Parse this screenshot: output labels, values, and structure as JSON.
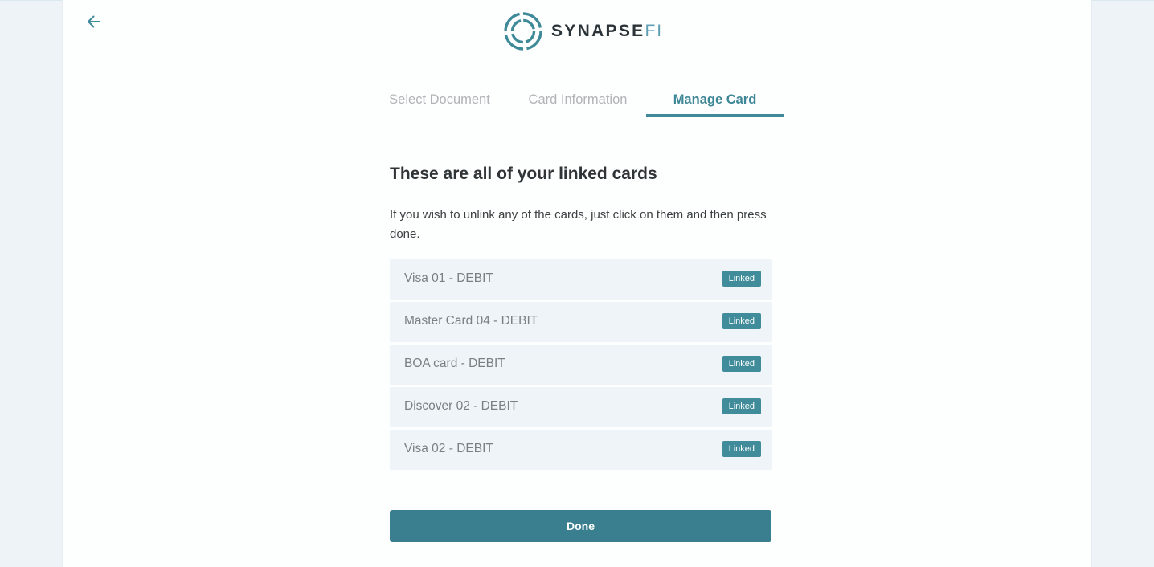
{
  "nav": {
    "back_icon": "arrow-left-icon"
  },
  "logo": {
    "icon": "synapsefi-ring-logo",
    "brand_main": "SYNAPSE",
    "brand_suffix": "FI"
  },
  "tabs": [
    {
      "label": "Select Document",
      "active": false
    },
    {
      "label": "Card Information",
      "active": false
    },
    {
      "label": "Manage Card",
      "active": true
    }
  ],
  "main": {
    "heading": "These are all of your linked cards",
    "description": "If you wish to unlink any of the cards, just click on them and then press done.",
    "cards": [
      {
        "name": "Visa 01 - DEBIT",
        "status": "Linked"
      },
      {
        "name": "Master Card 04 - DEBIT",
        "status": "Linked"
      },
      {
        "name": "BOA card - DEBIT",
        "status": "Linked"
      },
      {
        "name": "Discover 02 - DEBIT",
        "status": "Linked"
      },
      {
        "name": "Visa 02 - DEBIT",
        "status": "Linked"
      }
    ],
    "done_label": "Done"
  },
  "colors": {
    "accent": "#3f8a99",
    "button": "#3a7f8f",
    "card_bg": "#eef4f8",
    "page_bg": "#eef3f8"
  }
}
